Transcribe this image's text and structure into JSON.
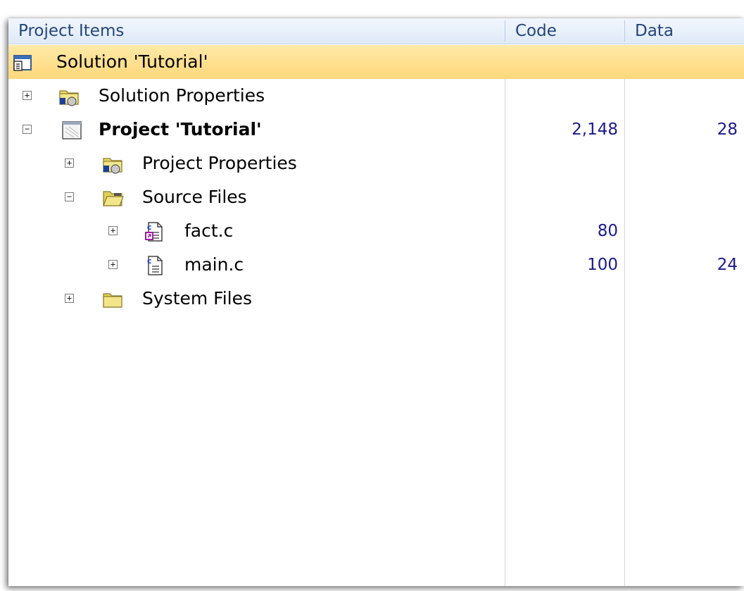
{
  "columns": {
    "items": "Project Items",
    "code": "Code",
    "data": "Data"
  },
  "rows": [
    {
      "label": "Solution 'Tutorial'",
      "code": "",
      "data": "",
      "icon": "solution-icon",
      "expander": ""
    },
    {
      "label": "Solution Properties",
      "code": "",
      "data": "",
      "icon": "properties-folder-icon",
      "expander": "+"
    },
    {
      "label": "Project 'Tutorial'",
      "code": "2,148",
      "data": "28",
      "icon": "project-icon",
      "expander": "−"
    },
    {
      "label": "Project Properties",
      "code": "",
      "data": "",
      "icon": "properties-folder-icon",
      "expander": "+"
    },
    {
      "label": "Source Files",
      "code": "",
      "data": "",
      "icon": "open-folder-icon",
      "expander": "−"
    },
    {
      "label": "fact.c",
      "code": "80",
      "data": "",
      "icon": "c-file-link-icon",
      "expander": "+"
    },
    {
      "label": "main.c",
      "code": "100",
      "data": "24",
      "icon": "c-file-icon",
      "expander": "+"
    },
    {
      "label": "System Files",
      "code": "",
      "data": "",
      "icon": "folder-icon",
      "expander": "+"
    }
  ],
  "colors": {
    "selected_row": "#ffd87a",
    "header": "#dfeaf8",
    "number": "#1a1a8c"
  }
}
